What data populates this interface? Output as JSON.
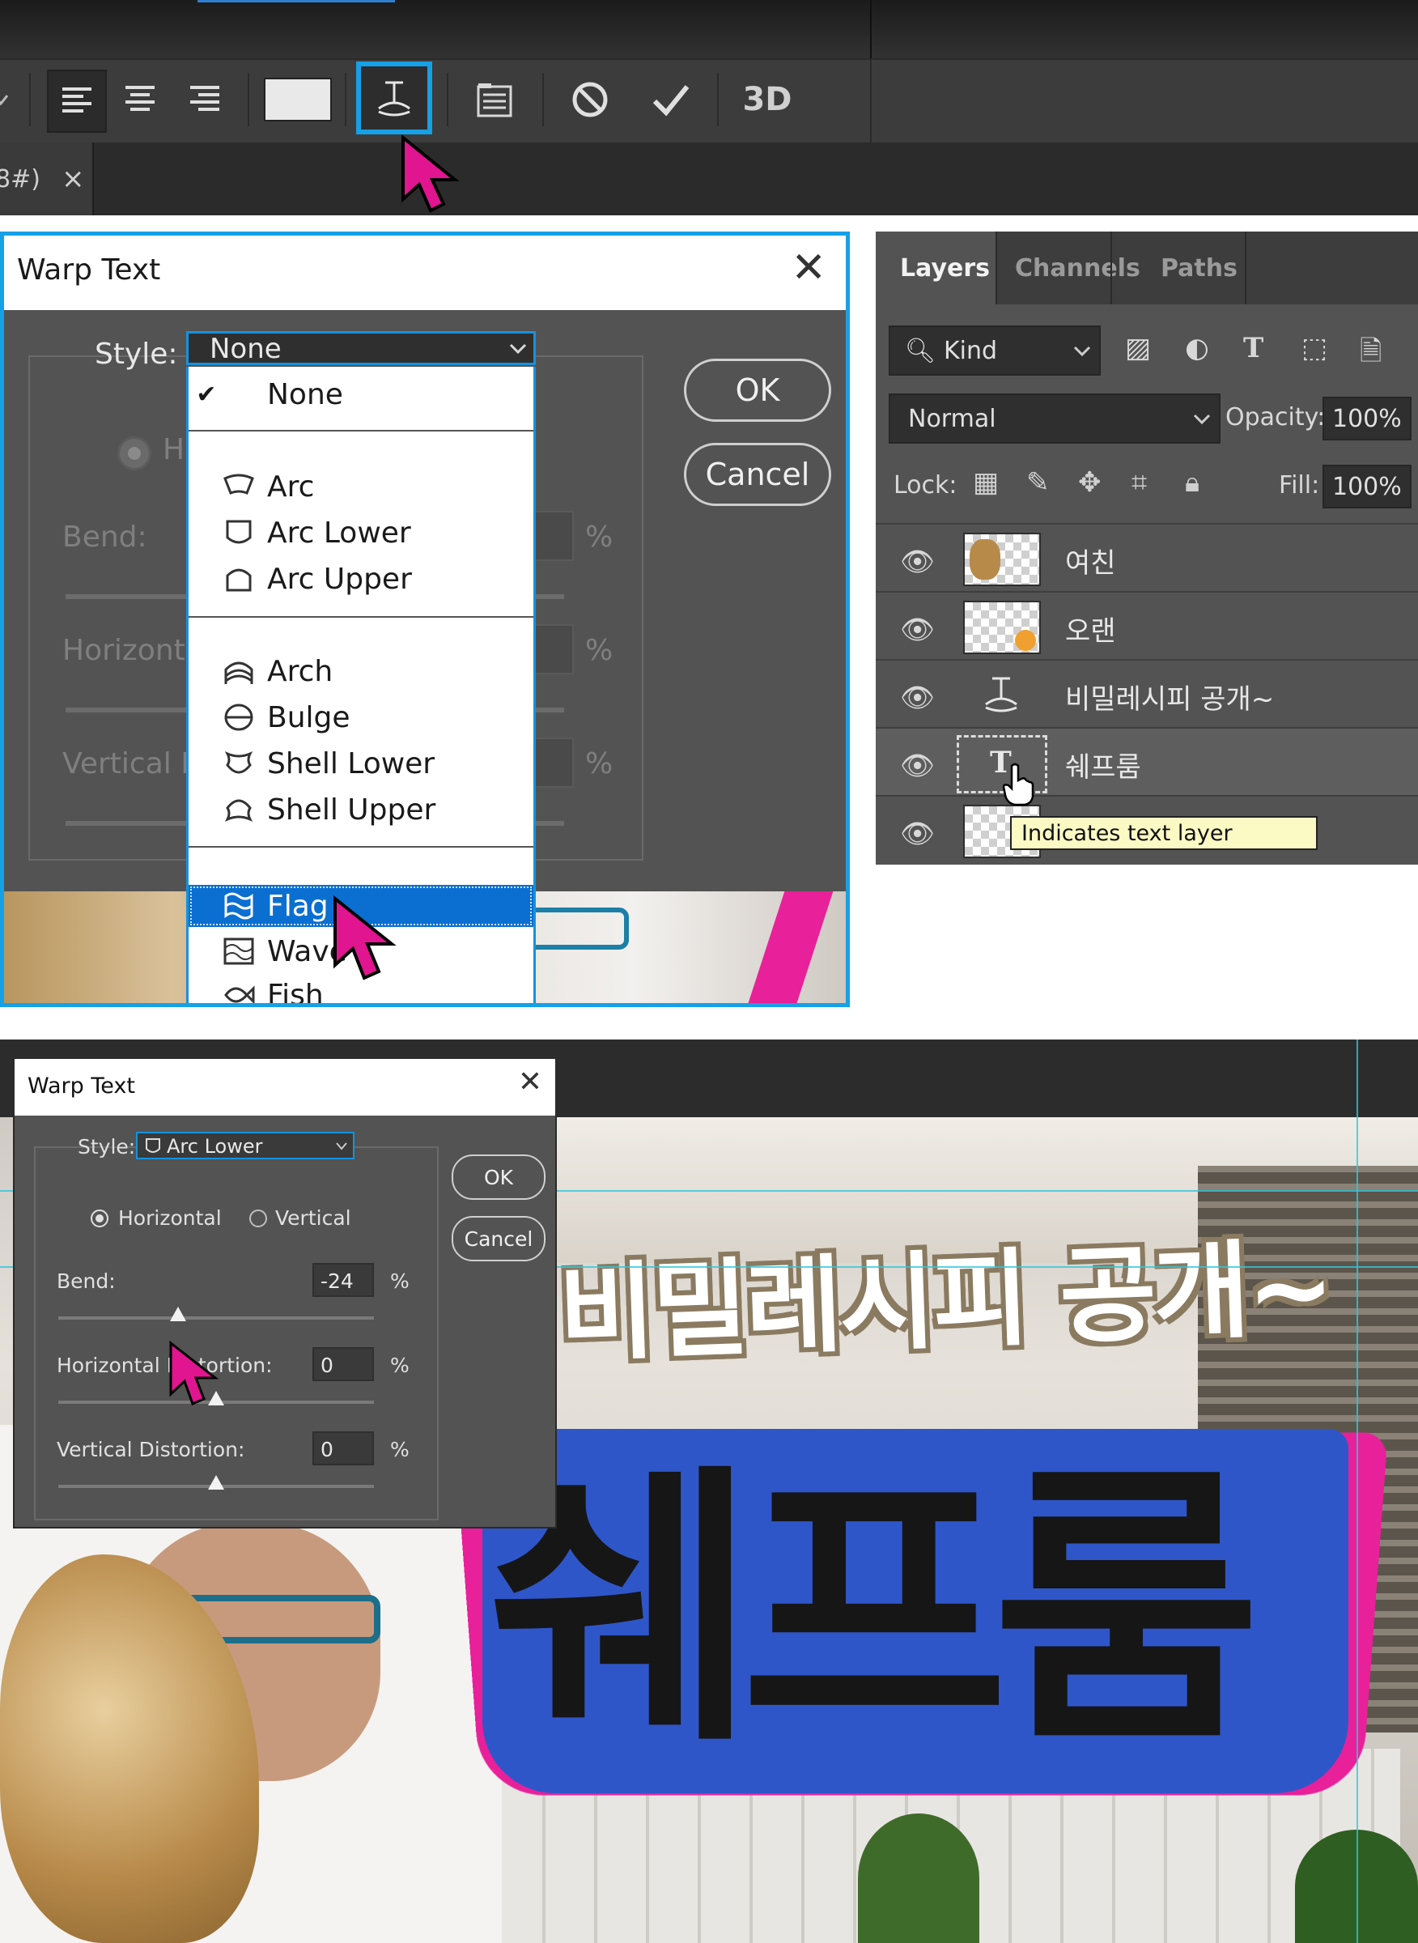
{
  "toolbar": {
    "doc_tab_label": "8#)",
    "doc_tab_close": "×",
    "cancel_glyph": "⃠",
    "commit_glyph": "✓",
    "threed_label": "3D"
  },
  "warp_dialog_1": {
    "title": "Warp Text",
    "close": "✕",
    "style_label": "Style:",
    "style_value": "None",
    "ok": "OK",
    "cancel": "Cancel",
    "radio_label_partial": "H",
    "bend_label": "Bend:",
    "horizontal_label": "Horizonta",
    "vertical_label": "Vertical D",
    "pct": "%",
    "dropdown_items": [
      {
        "label": "None",
        "checked": true,
        "icon": "check-icon"
      },
      {
        "label": "Arc",
        "icon": "arc-icon"
      },
      {
        "label": "Arc Lower",
        "icon": "arc-lower-icon"
      },
      {
        "label": "Arc Upper",
        "icon": "arc-upper-icon"
      },
      {
        "label": "Arch",
        "icon": "arch-icon"
      },
      {
        "label": "Bulge",
        "icon": "bulge-icon"
      },
      {
        "label": "Shell Lower",
        "icon": "shell-lower-icon"
      },
      {
        "label": "Shell Upper",
        "icon": "shell-upper-icon"
      },
      {
        "label": "Flag",
        "icon": "flag-icon",
        "highlighted": true
      },
      {
        "label": "Wave",
        "icon": "wave-icon"
      },
      {
        "label": "Fish",
        "icon": "fish-icon"
      }
    ]
  },
  "layers_panel": {
    "tabs": [
      "Layers",
      "Channels",
      "Paths"
    ],
    "kind_label": "Kind",
    "blend_mode": "Normal",
    "opacity_label": "Opacity:",
    "opacity_value": "100%",
    "lock_label": "Lock:",
    "fill_label": "Fill:",
    "fill_value": "100%",
    "layers": [
      {
        "name": "여친",
        "type": "image"
      },
      {
        "name": "오랜",
        "type": "image"
      },
      {
        "name": "비밀레시피 공개~",
        "type": "warped-text"
      },
      {
        "name": "쉐프룸",
        "type": "text"
      },
      {
        "name": "",
        "type": "image"
      }
    ],
    "tooltip": "Indicates text layer"
  },
  "warp_dialog_2": {
    "title": "Warp Text",
    "close": "✕",
    "style_label": "Style:",
    "style_value": "Arc Lower",
    "horizontal": "Horizontal",
    "vertical": "Vertical",
    "orientation_selected": "horizontal",
    "bend_label": "Bend:",
    "bend_value": "-24",
    "horizontal_distortion_label": "Horizontal Distortion:",
    "horizontal_distortion_value": "0",
    "vertical_distortion_label": "Vertical Distortion:",
    "vertical_distortion_value": "0",
    "pct": "%",
    "ok": "OK",
    "cancel": "Cancel",
    "bend_level_percent": -24,
    "hdist_level_percent": 0,
    "vdist_level_percent": 0
  },
  "canvas": {
    "headline": "비밀레시피 공개~",
    "title_text": "쉐프룸"
  },
  "colors": {
    "accent_blue": "#16a0e6",
    "cursor_magenta": "#e0158f",
    "highlight_blue": "#0a6fd1",
    "text_fill_blue": "#2f56c9"
  }
}
